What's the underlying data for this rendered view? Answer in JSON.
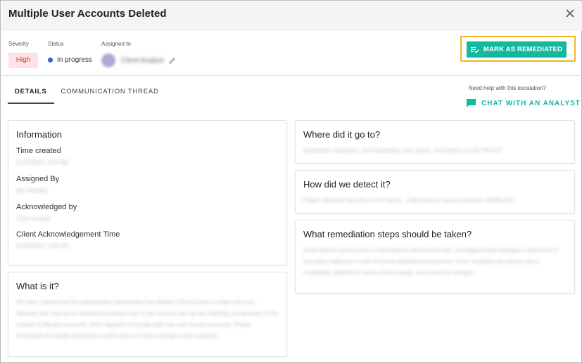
{
  "dialog": {
    "title": "Multiple User Accounts Deleted"
  },
  "meta": {
    "severity_label": "Severity",
    "severity_value": "High",
    "status_label": "Status",
    "status_value": "In progress",
    "assigned_label": "Assigned to",
    "assigned_value": "Client Analyst"
  },
  "actions": {
    "remediate_label": "MARK AS REMEDIATED"
  },
  "tabs": [
    {
      "label": "DETAILS"
    },
    {
      "label": "COMMUNICATION THREAD"
    }
  ],
  "help": {
    "text": "Need help with this escalation?",
    "chat_label": "CHAT WITH AN ANALYST"
  },
  "information": {
    "title": "Information",
    "fields": [
      {
        "label": "Time created",
        "value": "01/15/2022, 3:52 AM"
      },
      {
        "label": "Assigned By",
        "value": "Ben Markley"
      },
      {
        "label": "Acknowledged by",
        "value": "Client Analyst"
      },
      {
        "label": "Client Acknowledgement Time",
        "value": "01/20/2022, 3:40 PM"
      }
    ]
  },
  "what_is_it": {
    "title": "What is it?",
    "body": "We have noticed that the administrator listed below has deleted 103 accounts in under one hour. Although this may be an expected procedure due to the account sets we are notifying you because of the volume of affected accounts, which appears to include both user and service accounts. Please investigate the details below and confirm with us if these changes were expected."
  },
  "where": {
    "title": "Where did it go to?",
    "body": "Destination Hostname: dc2 Destination User Name: SVCAdmin at 3:42 PM EST"
  },
  "how": {
    "title": "How did we detect it?",
    "body": "Plugin: Windows Security (4,712 items) - 4,666 Items in Source Domain: ADMIN.INC"
  },
  "remediation": {
    "title": "What remediation steps should be taken?",
    "body": "Verify that the source user is authorized to perform this task. Investigate these changes to determine if they were malicious or part of normal operational processes. If not, invalidate the source user's credentials, identify the cause of the change, and revert the changes."
  },
  "icons": {
    "close": "close-icon",
    "remediate": "checklist-icon",
    "chat": "chat-bubble-icon",
    "edit": "pencil-icon"
  },
  "colors": {
    "accent": "#13b99e",
    "highlight_border": "#f0b429",
    "severity_bg": "#fde3e3",
    "severity_text": "#dd3333",
    "status_dot": "#3b5bdb"
  }
}
